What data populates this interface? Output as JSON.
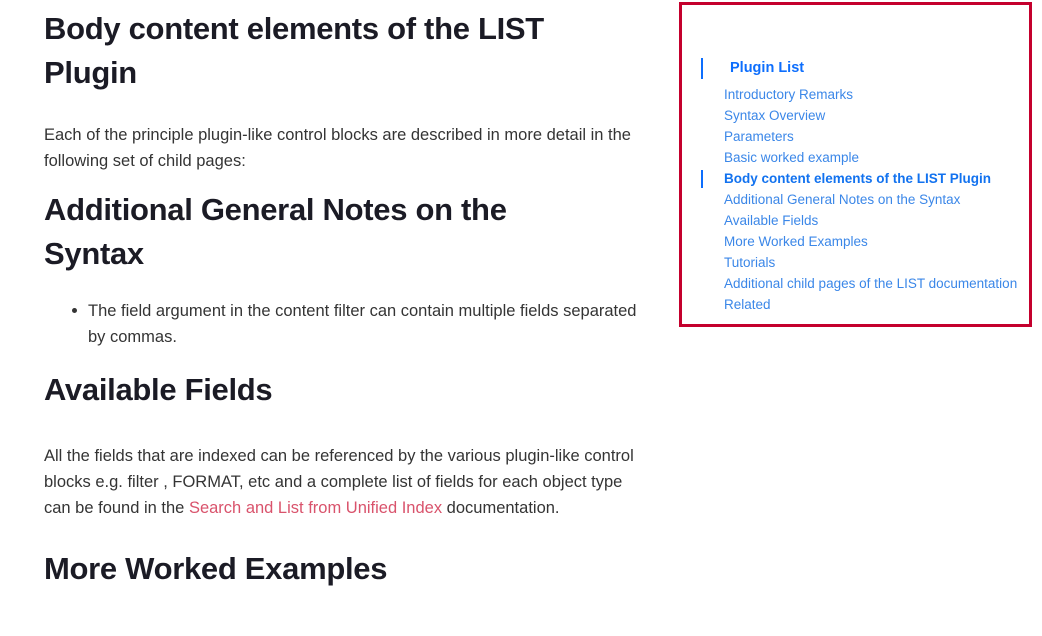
{
  "colors": {
    "panel_border": "#c4002d",
    "toc_link": "#3b87e8",
    "toc_active": "#1272ef",
    "toc_accent_bar": "#0d6efd",
    "inline_link": "#d9536c",
    "heading": "#1b1b25",
    "body_text": "#343434"
  },
  "article": {
    "heading_body_content": "Body content elements of the LIST Plugin",
    "intro_paragraph": "Each of the principle plugin-like control blocks are described in more detail in the following set of child pages:",
    "heading_additional_notes": "Additional General Notes on the Syntax",
    "notes": [
      "The field argument in the content filter can contain multiple fields separated by commas."
    ],
    "heading_available_fields": "Available Fields",
    "available_fields_paragraph": {
      "before_link": "All the fields that are indexed can be referenced by the various plugin-like control blocks e.g. filter , FORMAT, etc and a complete list of fields for each object type can be found in the ",
      "link_text": "Search and List from Unified Index",
      "after_link": " documentation."
    },
    "heading_more_examples": "More Worked Examples"
  },
  "toc": {
    "title": "Plugin List",
    "items": [
      {
        "label": "Introductory Remarks",
        "active": false
      },
      {
        "label": "Syntax Overview",
        "active": false
      },
      {
        "label": "Parameters",
        "active": false
      },
      {
        "label": "Basic worked example",
        "active": false
      },
      {
        "label": "Body content elements of the LIST Plugin",
        "active": true
      },
      {
        "label": "Additional General Notes on the Syntax",
        "active": false
      },
      {
        "label": "Available Fields",
        "active": false
      },
      {
        "label": "More Worked Examples",
        "active": false
      },
      {
        "label": "Tutorials",
        "active": false
      },
      {
        "label": "Additional child pages of the LIST documentation",
        "active": false
      },
      {
        "label": "Related",
        "active": false
      }
    ]
  }
}
